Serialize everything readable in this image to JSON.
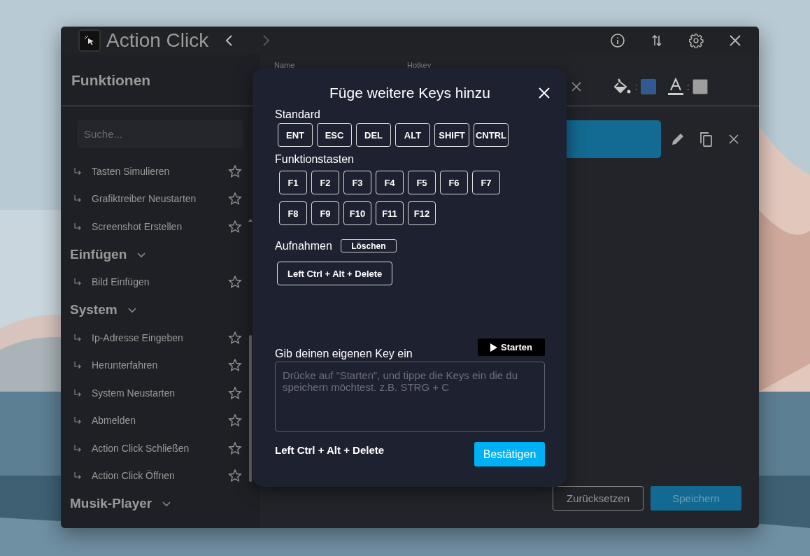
{
  "app": {
    "title": "Action Click"
  },
  "sidebar": {
    "title": "Funktionen",
    "search": {
      "placeholder": "Suche..."
    },
    "groups": [
      {
        "items": [
          {
            "label": "Tasten Simulieren"
          },
          {
            "label": "Grafiktreiber Neustarten"
          },
          {
            "label": "Screenshot Erstellen"
          }
        ]
      },
      {
        "title": "Einfügen",
        "expanded": true,
        "items": [
          {
            "label": "Bild Einfügen"
          }
        ]
      },
      {
        "title": "System",
        "expanded": true,
        "items": [
          {
            "label": "Ip-Adresse Eingeben"
          },
          {
            "label": "Herunterfahren"
          },
          {
            "label": "System Neustarten"
          },
          {
            "label": "Abmelden"
          },
          {
            "label": "Action Click Schließen"
          },
          {
            "label": "Action Click Öffnen"
          }
        ]
      },
      {
        "title": "Musik-Player",
        "expanded": true
      }
    ]
  },
  "editor": {
    "name_label": "Name",
    "hotkey_label": "Hotkey",
    "color_pickers": [
      {
        "kind": "fill",
        "separator": ":",
        "color": "#2f5a94"
      },
      {
        "kind": "text",
        "separator": ":",
        "color": "#9e9e9e"
      }
    ]
  },
  "footer": {
    "buttons": [
      {
        "label": "Zurücksetzen",
        "kind": "outline"
      },
      {
        "label": "Speichern",
        "kind": "primary"
      }
    ]
  },
  "dialog": {
    "title": "Füge weitere Keys hinzu",
    "standard": {
      "label": "Standard",
      "keys": [
        "ENT",
        "ESC",
        "DEL",
        "ALT",
        "SHIFT",
        "CNTRL"
      ]
    },
    "function_keys": {
      "label": "Funktionstasten",
      "keys": [
        "F1",
        "F2",
        "F3",
        "F4",
        "F5",
        "F6",
        "F7",
        "F8",
        "F9",
        "F10",
        "F11",
        "F12"
      ]
    },
    "recordings": {
      "label": "Aufnahmen",
      "clear_button": "Löschen",
      "items": [
        "Left Ctrl + Alt + Delete"
      ]
    },
    "custom": {
      "label": "Gib deinen eigenen Key ein",
      "start_button": "Starten",
      "placeholder": "Drücke auf “Starten”, und tippe die Keys ein die du speichern möchtest. z.B. STRG + C",
      "result": "Left Ctrl + Alt + Delete",
      "confirm_button": "Bestätigen"
    }
  }
}
